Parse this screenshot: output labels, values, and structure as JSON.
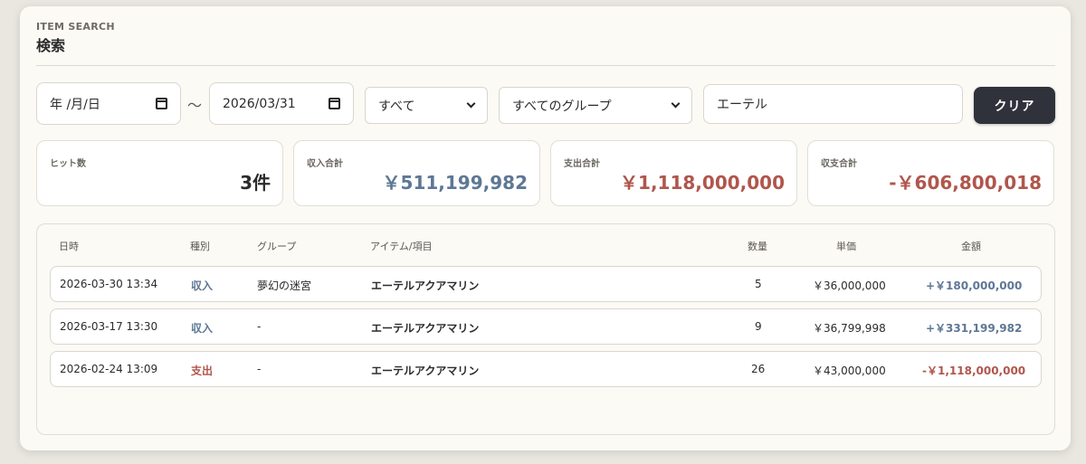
{
  "header": {
    "eyebrow": "ITEM SEARCH",
    "title": "検索"
  },
  "filters": {
    "date_from": "年 /月/日",
    "date_sep": "～",
    "date_to": "2026/03/31",
    "type_select": "すべて",
    "group_select": "すべてのグループ",
    "keyword": "エーテル",
    "clear_label": "クリア"
  },
  "stats": {
    "hits": {
      "label": "ヒット数",
      "value": "3件"
    },
    "income": {
      "label": "収入合計",
      "value": "￥511,199,982"
    },
    "expense": {
      "label": "支出合計",
      "value": "￥1,118,000,000"
    },
    "balance": {
      "label": "収支合計",
      "value": "-￥606,800,018"
    }
  },
  "table": {
    "headers": [
      "日時",
      "種別",
      "グループ",
      "アイテム/項目",
      "数量",
      "単価",
      "金額"
    ],
    "rows": [
      {
        "datetime": "2026-03-30 13:34",
        "type": "収入",
        "group": "夢幻の迷宮",
        "item": "エーテルアクアマリン",
        "qty": "5",
        "unit_price": "￥36,000,000",
        "amount": "+￥180,000,000"
      },
      {
        "datetime": "2026-03-17 13:30",
        "type": "収入",
        "group": "-",
        "item": "エーテルアクアマリン",
        "qty": "9",
        "unit_price": "￥36,799,998",
        "amount": "+￥331,199,982"
      },
      {
        "datetime": "2026-02-24 13:09",
        "type": "支出",
        "group": "-",
        "item": "エーテルアクアマリン",
        "qty": "26",
        "unit_price": "￥43,000,000",
        "amount": "-￥1,118,000,000"
      }
    ]
  },
  "colors": {
    "income": "#5e7795",
    "expense": "#b0564c",
    "button": "#2f323a"
  },
  "icons": {
    "date": "calendar-icon",
    "select": "chevron-down-icon"
  }
}
